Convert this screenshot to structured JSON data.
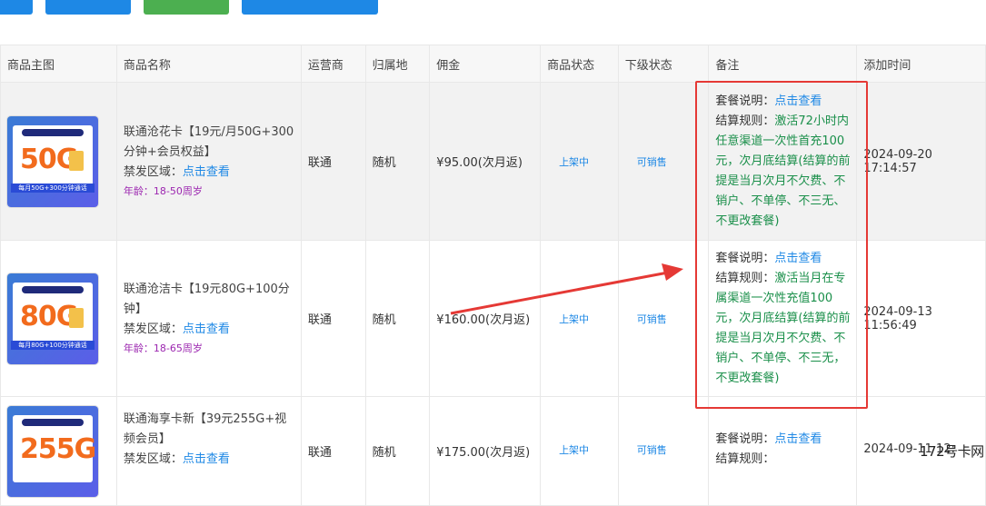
{
  "toolbar": {
    "buttons": [
      {
        "label": "",
        "color": "#1e88e5"
      },
      {
        "label": "",
        "color": "#1e88e5"
      },
      {
        "label": "",
        "color": "#4caf50"
      },
      {
        "label": "",
        "color": "#1e88e5"
      }
    ]
  },
  "table": {
    "headers": [
      "商品主图",
      "商品名称",
      "运营商",
      "归属地",
      "佣金",
      "商品状态",
      "下级状态",
      "备注",
      "添加时间"
    ],
    "rows": [
      {
        "image": {
          "big": "50G",
          "sub": "每月50G+300分钟通话"
        },
        "name": "联通沧花卡【19元/月50G+300分钟+会员权益】",
        "area_label": "禁发区域：",
        "area_link": "点击查看",
        "age": "年龄：18-50周岁",
        "operator": "联通",
        "location": "随机",
        "commission": "¥95.00(次月返)",
        "status": "上架中",
        "sub_status": "可销售",
        "note_label1": "套餐说明：",
        "note_link": "点击查看",
        "note_label2": "结算规则：",
        "note_rule": "激活72小时内任意渠道一次性首充100元，次月底结算(结算的前提是当月次月不欠费、不销户、不单停、不三无、不更改套餐)",
        "added": "2024-09-20 17:14:57"
      },
      {
        "image": {
          "big": "80G",
          "sub": "每月80G+100分钟通话"
        },
        "name": "联通沧洁卡【19元80G+100分钟】",
        "area_label": "禁发区域：",
        "area_link": "点击查看",
        "age": "年龄：18-65周岁",
        "operator": "联通",
        "location": "随机",
        "commission": "¥160.00(次月返)",
        "status": "上架中",
        "sub_status": "可销售",
        "note_label1": "套餐说明：",
        "note_link": "点击查看",
        "note_label2": "结算规则：",
        "note_rule": "激活当月在专属渠道一次性充值100元，次月底结算(结算的前提是当月次月不欠费、不销户、不单停、不三无，不更改套餐)",
        "added": "2024-09-13 11:56:49"
      },
      {
        "image": {
          "big": "255G",
          "sub": ""
        },
        "name": "联通海享卡新【39元255G+视频会员】",
        "area_label": "禁发区域：",
        "area_link": "点击查看",
        "age": "",
        "operator": "联通",
        "location": "随机",
        "commission": "¥175.00(次月返)",
        "status": "上架中",
        "sub_status": "可销售",
        "note_label1": "套餐说明：",
        "note_link": "点击查看",
        "note_label2": "结算规则：",
        "note_rule": "",
        "added": "2024-09-11 12:"
      }
    ]
  },
  "watermark": "172号卡网",
  "colors": {
    "link": "#1e88e5",
    "green": "#1a8f4a",
    "purple": "#9c27b0",
    "annotation": "#e53935"
  }
}
